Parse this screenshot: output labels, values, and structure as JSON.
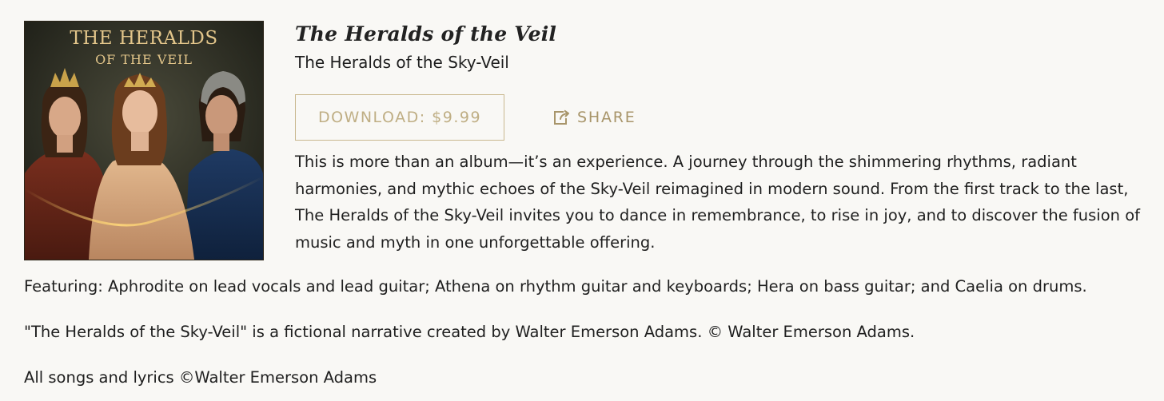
{
  "cover": {
    "title_line1": "THE HERALDS",
    "title_line2": "OF THE VEIL",
    "image": "album-cover-art"
  },
  "album": {
    "title": "The Heralds of the Veil",
    "subtitle": "The Heralds of the Sky-Veil"
  },
  "actions": {
    "download_label": "DOWNLOAD: $9.99",
    "share_label": "SHARE",
    "share_icon": "share-icon"
  },
  "description": "This is more than an album—it’s an experience. A journey through the shimmering rhythms, radiant harmonies, and mythic echoes of the Sky-Veil reimagined in modern sound. From the first track to the last, The Heralds of the Sky-Veil invites you to dance in remembrance, to rise in joy, and to discover the fusion of music and myth in one unforgettable offering.",
  "featuring": "Featuring: Aphrodite on lead vocals and lead guitar; Athena on rhythm guitar and keyboards; Hera on bass guitar; and Caelia on drums.",
  "disclaimer": "\"The Heralds of the Sky-Veil\" is a fictional narrative created by Walter Emerson Adams. © Walter Emerson Adams.",
  "copyright": "All songs and lyrics ©Walter Emerson Adams",
  "colors": {
    "accent": "#bfae84",
    "background": "#f9f8f5",
    "text": "#1f1f1f"
  }
}
